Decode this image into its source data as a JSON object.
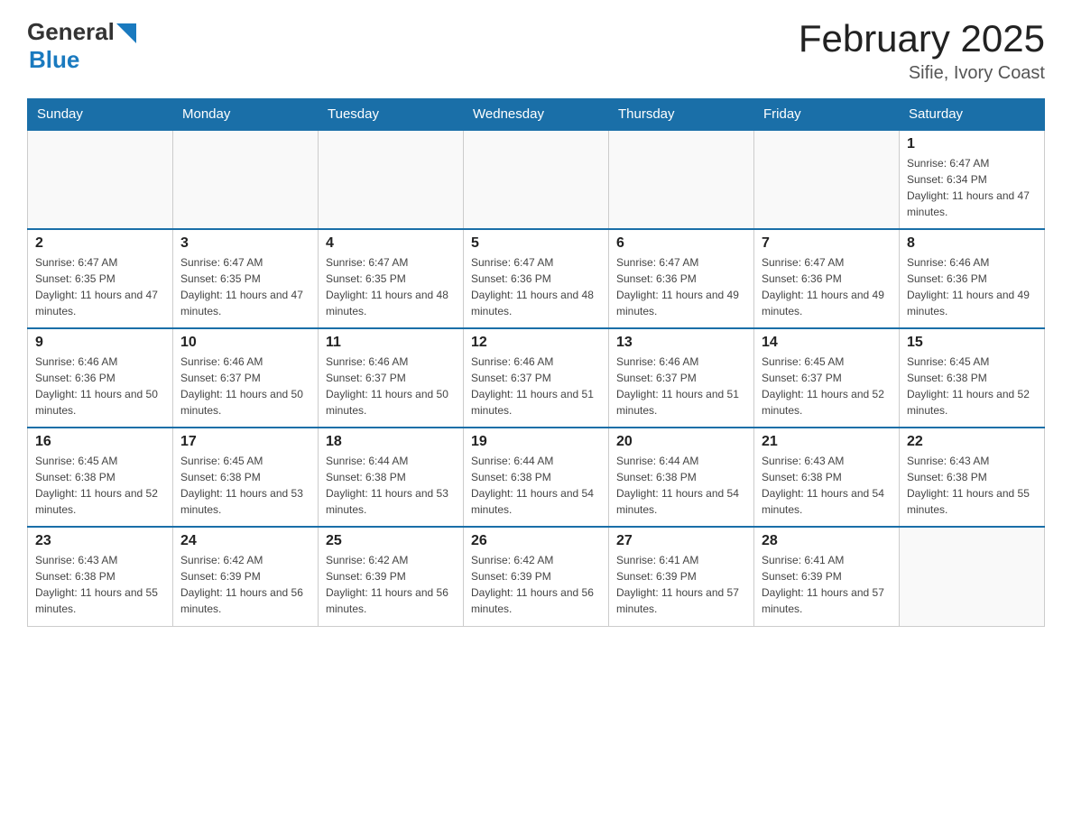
{
  "header": {
    "logo_general": "General",
    "logo_blue": "Blue",
    "month_title": "February 2025",
    "location": "Sifie, Ivory Coast"
  },
  "days_of_week": [
    "Sunday",
    "Monday",
    "Tuesday",
    "Wednesday",
    "Thursday",
    "Friday",
    "Saturday"
  ],
  "weeks": [
    [
      {
        "day": "",
        "info": ""
      },
      {
        "day": "",
        "info": ""
      },
      {
        "day": "",
        "info": ""
      },
      {
        "day": "",
        "info": ""
      },
      {
        "day": "",
        "info": ""
      },
      {
        "day": "",
        "info": ""
      },
      {
        "day": "1",
        "info": "Sunrise: 6:47 AM\nSunset: 6:34 PM\nDaylight: 11 hours and 47 minutes."
      }
    ],
    [
      {
        "day": "2",
        "info": "Sunrise: 6:47 AM\nSunset: 6:35 PM\nDaylight: 11 hours and 47 minutes."
      },
      {
        "day": "3",
        "info": "Sunrise: 6:47 AM\nSunset: 6:35 PM\nDaylight: 11 hours and 47 minutes."
      },
      {
        "day": "4",
        "info": "Sunrise: 6:47 AM\nSunset: 6:35 PM\nDaylight: 11 hours and 48 minutes."
      },
      {
        "day": "5",
        "info": "Sunrise: 6:47 AM\nSunset: 6:36 PM\nDaylight: 11 hours and 48 minutes."
      },
      {
        "day": "6",
        "info": "Sunrise: 6:47 AM\nSunset: 6:36 PM\nDaylight: 11 hours and 49 minutes."
      },
      {
        "day": "7",
        "info": "Sunrise: 6:47 AM\nSunset: 6:36 PM\nDaylight: 11 hours and 49 minutes."
      },
      {
        "day": "8",
        "info": "Sunrise: 6:46 AM\nSunset: 6:36 PM\nDaylight: 11 hours and 49 minutes."
      }
    ],
    [
      {
        "day": "9",
        "info": "Sunrise: 6:46 AM\nSunset: 6:36 PM\nDaylight: 11 hours and 50 minutes."
      },
      {
        "day": "10",
        "info": "Sunrise: 6:46 AM\nSunset: 6:37 PM\nDaylight: 11 hours and 50 minutes."
      },
      {
        "day": "11",
        "info": "Sunrise: 6:46 AM\nSunset: 6:37 PM\nDaylight: 11 hours and 50 minutes."
      },
      {
        "day": "12",
        "info": "Sunrise: 6:46 AM\nSunset: 6:37 PM\nDaylight: 11 hours and 51 minutes."
      },
      {
        "day": "13",
        "info": "Sunrise: 6:46 AM\nSunset: 6:37 PM\nDaylight: 11 hours and 51 minutes."
      },
      {
        "day": "14",
        "info": "Sunrise: 6:45 AM\nSunset: 6:37 PM\nDaylight: 11 hours and 52 minutes."
      },
      {
        "day": "15",
        "info": "Sunrise: 6:45 AM\nSunset: 6:38 PM\nDaylight: 11 hours and 52 minutes."
      }
    ],
    [
      {
        "day": "16",
        "info": "Sunrise: 6:45 AM\nSunset: 6:38 PM\nDaylight: 11 hours and 52 minutes."
      },
      {
        "day": "17",
        "info": "Sunrise: 6:45 AM\nSunset: 6:38 PM\nDaylight: 11 hours and 53 minutes."
      },
      {
        "day": "18",
        "info": "Sunrise: 6:44 AM\nSunset: 6:38 PM\nDaylight: 11 hours and 53 minutes."
      },
      {
        "day": "19",
        "info": "Sunrise: 6:44 AM\nSunset: 6:38 PM\nDaylight: 11 hours and 54 minutes."
      },
      {
        "day": "20",
        "info": "Sunrise: 6:44 AM\nSunset: 6:38 PM\nDaylight: 11 hours and 54 minutes."
      },
      {
        "day": "21",
        "info": "Sunrise: 6:43 AM\nSunset: 6:38 PM\nDaylight: 11 hours and 54 minutes."
      },
      {
        "day": "22",
        "info": "Sunrise: 6:43 AM\nSunset: 6:38 PM\nDaylight: 11 hours and 55 minutes."
      }
    ],
    [
      {
        "day": "23",
        "info": "Sunrise: 6:43 AM\nSunset: 6:38 PM\nDaylight: 11 hours and 55 minutes."
      },
      {
        "day": "24",
        "info": "Sunrise: 6:42 AM\nSunset: 6:39 PM\nDaylight: 11 hours and 56 minutes."
      },
      {
        "day": "25",
        "info": "Sunrise: 6:42 AM\nSunset: 6:39 PM\nDaylight: 11 hours and 56 minutes."
      },
      {
        "day": "26",
        "info": "Sunrise: 6:42 AM\nSunset: 6:39 PM\nDaylight: 11 hours and 56 minutes."
      },
      {
        "day": "27",
        "info": "Sunrise: 6:41 AM\nSunset: 6:39 PM\nDaylight: 11 hours and 57 minutes."
      },
      {
        "day": "28",
        "info": "Sunrise: 6:41 AM\nSunset: 6:39 PM\nDaylight: 11 hours and 57 minutes."
      },
      {
        "day": "",
        "info": ""
      }
    ]
  ]
}
